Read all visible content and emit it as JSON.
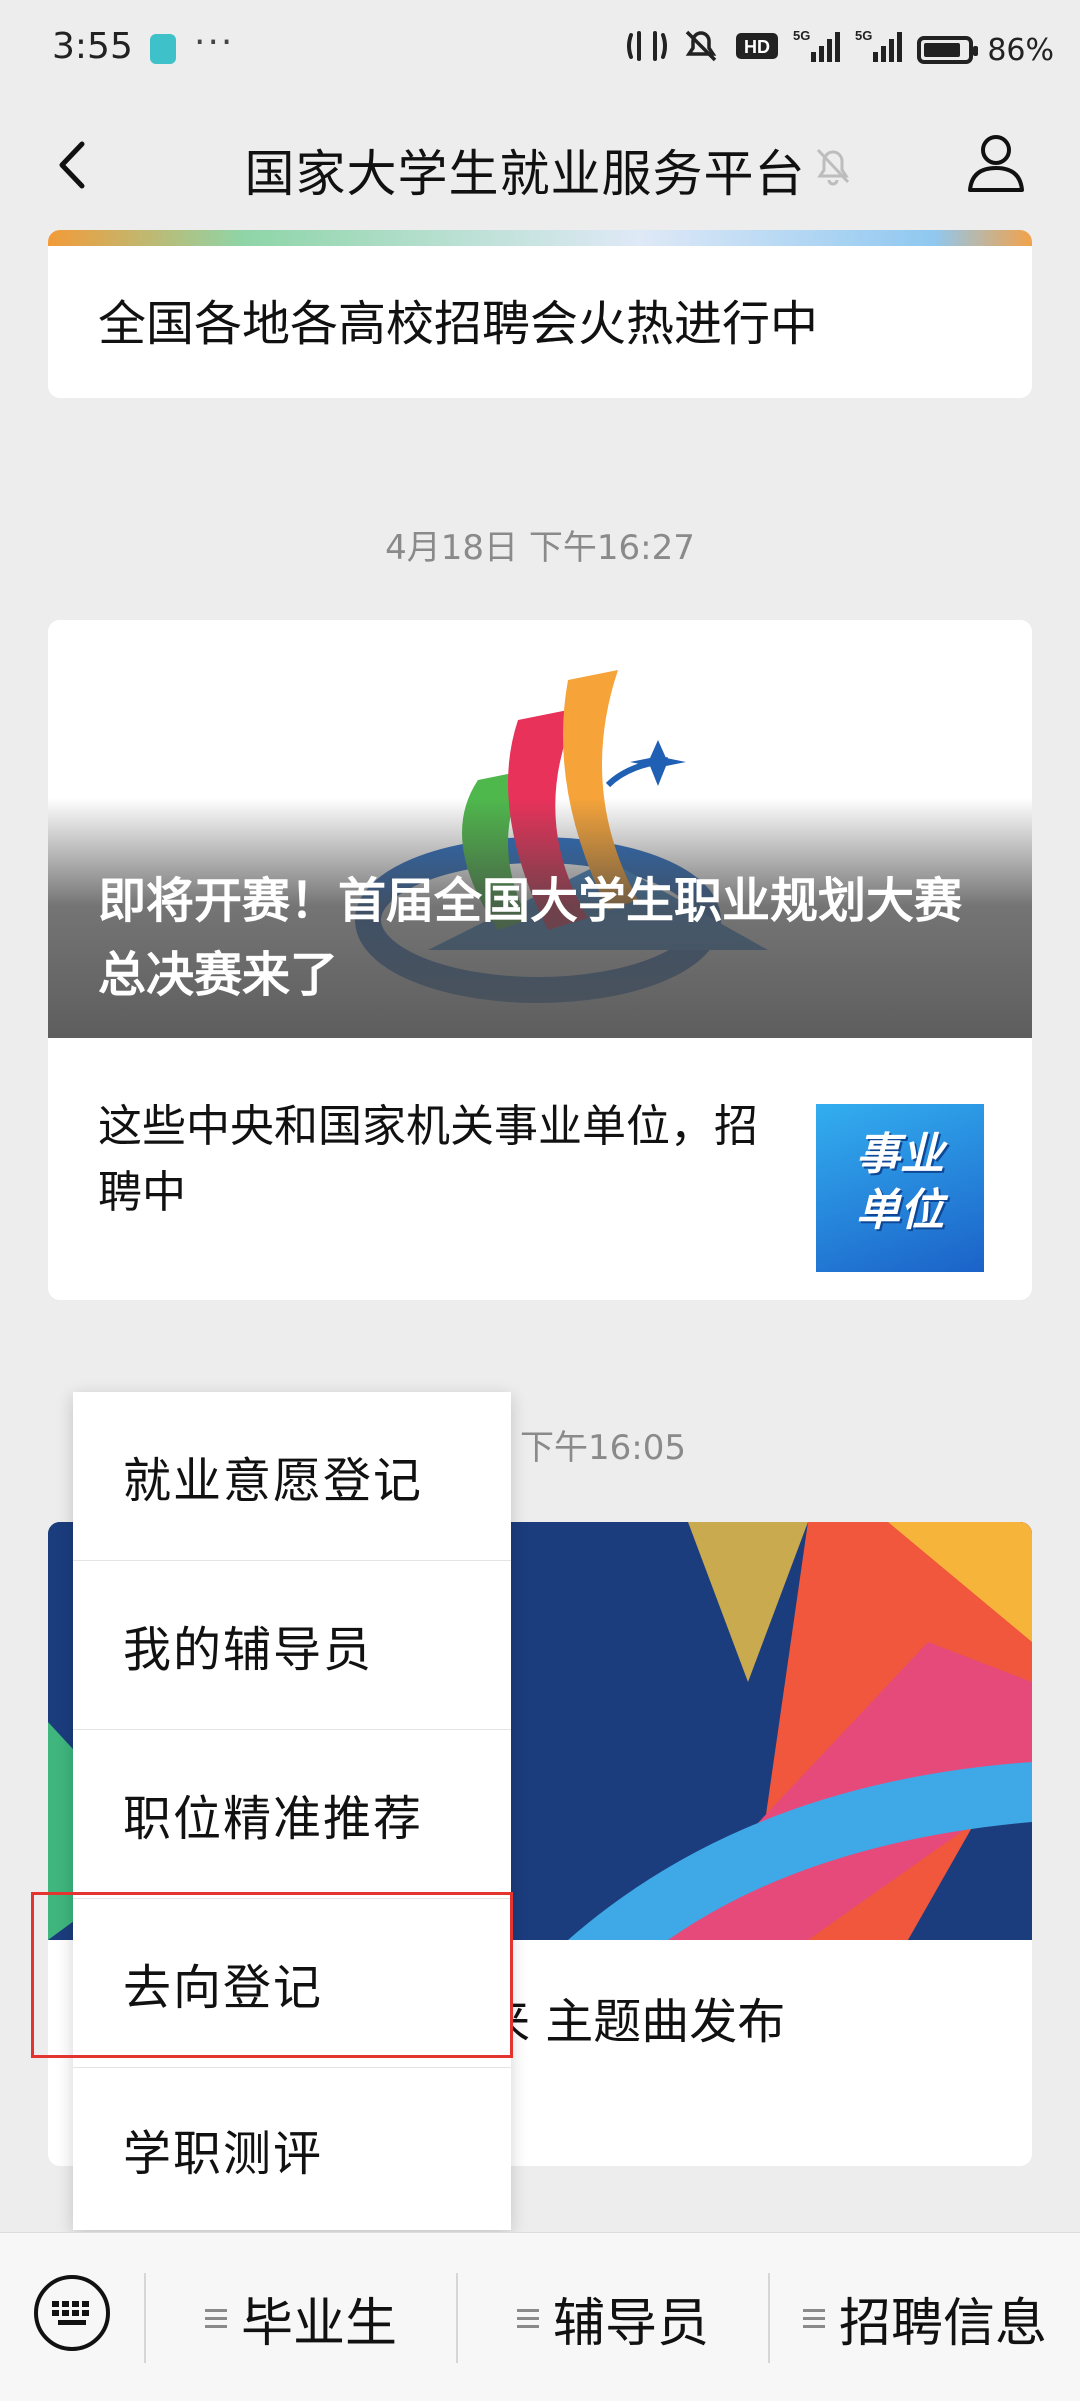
{
  "status_bar": {
    "time": "3:55",
    "dots": "···",
    "network": "5G",
    "hd": "HD",
    "battery": "86%",
    "battery_level": 0.86
  },
  "header": {
    "title": "国家大学生就业服务平台"
  },
  "feed": {
    "card1_text": "全国各地各高校招聘会火热进行中",
    "time1": "4月18日 下午16:27",
    "card2_banner_title": "即将开赛！首届全国大学生职业规划大赛总决赛来了",
    "card2_row_text": "这些中央和国家机关事业单位，招聘中",
    "thumb_line1": "事业",
    "thumb_line2": "单位",
    "time2": "下午16:05",
    "card3_row_text": "业规划大赛总决赛来 主题曲发布"
  },
  "popup_menu": {
    "items": [
      "就业意愿登记",
      "我的辅导员",
      "职位精准推荐",
      "去向登记",
      "学职测评"
    ],
    "highlighted_index": 3
  },
  "bottom_tabs": {
    "tabs": [
      "毕业生",
      "辅导员",
      "招聘信息"
    ]
  }
}
